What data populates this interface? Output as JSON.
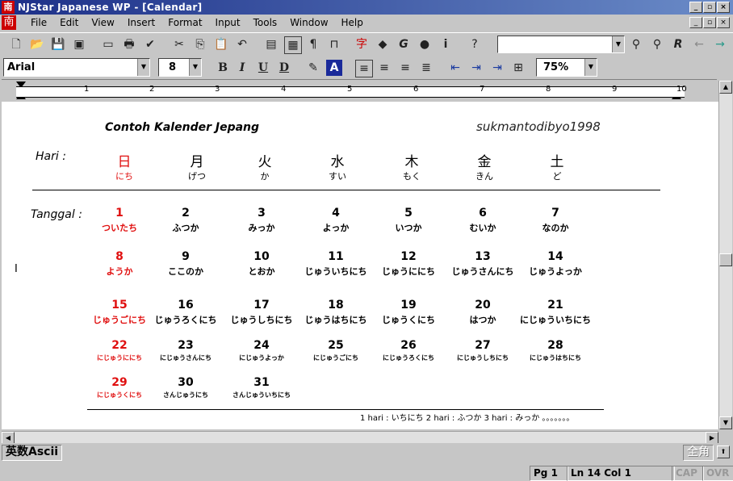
{
  "window": {
    "title": "NJStar Japanese WP - [Calendar]",
    "app_icon": "南",
    "buttons": [
      "_",
      "▫",
      "×"
    ]
  },
  "menu": {
    "items": [
      "File",
      "Edit",
      "View",
      "Insert",
      "Format",
      "Input",
      "Tools",
      "Window",
      "Help"
    ]
  },
  "toolbar": {
    "font_name": "Arial",
    "font_size": "8",
    "zoom": "75%",
    "bold": "B",
    "italic": "I",
    "underline": "U",
    "strike": "D",
    "font_color": "A",
    "search_value": ""
  },
  "ruler": {
    "marks": [
      "1",
      "2",
      "3",
      "4",
      "5",
      "6",
      "7",
      "8",
      "9",
      "10"
    ]
  },
  "calendar": {
    "title": "Contoh Kalender Jepang",
    "author": "sukmantodibyo1998",
    "hari_label": "Hari  :",
    "tanggal_label": "Tanggal :",
    "weekdays": [
      {
        "kanji": "日",
        "reading": "にち",
        "red": true
      },
      {
        "kanji": "月",
        "reading": "げつ",
        "red": false
      },
      {
        "kanji": "火",
        "reading": "か",
        "red": false
      },
      {
        "kanji": "水",
        "reading": "すい",
        "red": false
      },
      {
        "kanji": "木",
        "reading": "もく",
        "red": false
      },
      {
        "kanji": "金",
        "reading": "きん",
        "red": false
      },
      {
        "kanji": "土",
        "reading": "ど",
        "red": false
      }
    ],
    "weeks": [
      [
        {
          "n": "1",
          "r": "ついたち"
        },
        {
          "n": "2",
          "r": "ふつか"
        },
        {
          "n": "3",
          "r": "みっか"
        },
        {
          "n": "4",
          "r": "よっか"
        },
        {
          "n": "5",
          "r": "いつか"
        },
        {
          "n": "6",
          "r": "むいか"
        },
        {
          "n": "7",
          "r": "なのか"
        }
      ],
      [
        {
          "n": "8",
          "r": "ようか"
        },
        {
          "n": "9",
          "r": "ここのか"
        },
        {
          "n": "10",
          "r": "とおか"
        },
        {
          "n": "11",
          "r": "じゅういちにち"
        },
        {
          "n": "12",
          "r": "じゅうににち"
        },
        {
          "n": "13",
          "r": "じゅうさんにち"
        },
        {
          "n": "14",
          "r": "じゅうよっか"
        }
      ],
      [
        {
          "n": "15",
          "r": "じゅうごにち"
        },
        {
          "n": "16",
          "r": "じゅうろくにち"
        },
        {
          "n": "17",
          "r": "じゅうしちにち"
        },
        {
          "n": "18",
          "r": "じゅうはちにち"
        },
        {
          "n": "19",
          "r": "じゅうくにち"
        },
        {
          "n": "20",
          "r": "はつか"
        },
        {
          "n": "21",
          "r": "にじゅういちにち"
        }
      ],
      [
        {
          "n": "22",
          "r": "にじゅうににち"
        },
        {
          "n": "23",
          "r": "にじゅうさんにち"
        },
        {
          "n": "24",
          "r": "にじゅうよっか"
        },
        {
          "n": "25",
          "r": "にじゅうごにち"
        },
        {
          "n": "26",
          "r": "にじゅうろくにち"
        },
        {
          "n": "27",
          "r": "にじゅうしちにち"
        },
        {
          "n": "28",
          "r": "にじゅうはちにち"
        }
      ],
      [
        {
          "n": "29",
          "r": "にじゅうくにち"
        },
        {
          "n": "30",
          "r": "さんじゅうにち"
        },
        {
          "n": "31",
          "r": "さんじゅういちにち"
        }
      ]
    ],
    "footnote": "1 hari : いちにち   2 hari : ふつか   3 hari : みっか 。。。。。。。"
  },
  "ime": {
    "mode": "英数Ascii",
    "width": "全角"
  },
  "status": {
    "pg": "Pg 1",
    "position": "Ln 14 Col 1",
    "cap": "CAP",
    "ovr": "OVR"
  },
  "colors": {
    "title_bar_start": "#1c2f88",
    "title_bar_end": "#6b8cc8",
    "sunday_red": "#e01010",
    "chrome": "#c6c6c6"
  }
}
